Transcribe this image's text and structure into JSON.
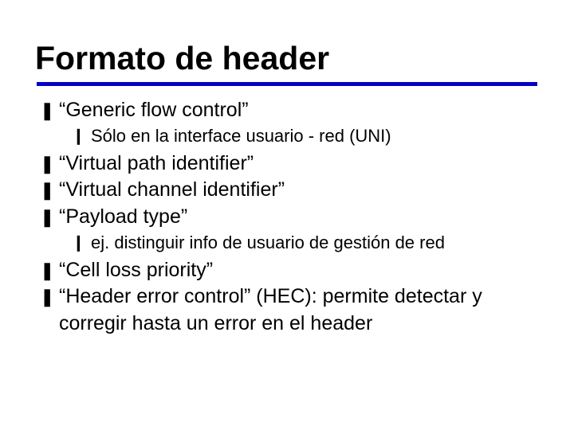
{
  "title": "Formato de header",
  "bullets": {
    "main_glyph": "❚",
    "sub_glyph": "❙"
  },
  "items": [
    {
      "text": "“Generic flow control”"
    },
    {
      "sub": true,
      "text": "Sólo en la interface usuario - red (UNI)"
    },
    {
      "text": "“Virtual path identifier”"
    },
    {
      "text": "“Virtual channel identifier”"
    },
    {
      "text": "“Payload type”"
    },
    {
      "sub": true,
      "text": "ej. distinguir info de usuario de gestión de red"
    },
    {
      "text": "“Cell loss priority”"
    },
    {
      "text": "“Header error control” (HEC): permite detectar y corregir hasta un error en el header"
    }
  ]
}
